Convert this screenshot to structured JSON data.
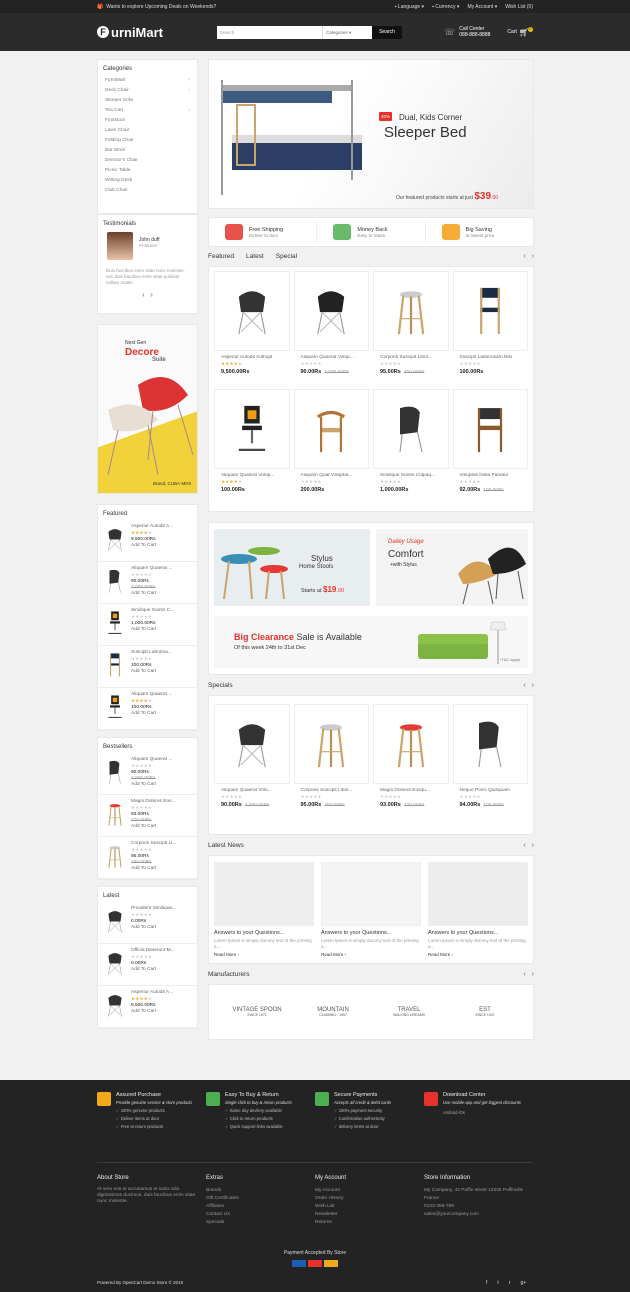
{
  "topbar": {
    "promo": "Wants to explore Upcoming Deals on Weekends?",
    "language": "Language",
    "currency": "Currency",
    "account": "My Account",
    "wishlist": "Wish List (0)"
  },
  "header": {
    "logo_letter": "F",
    "logo_rest": "urniMart",
    "search_placeholder": "Search",
    "search_category": "Categories",
    "search_button": "Search",
    "call_label": "Call Center",
    "call_number": "088-888-8888",
    "cart_label": "Cart",
    "cart_count": "0"
  },
  "sidebar": {
    "categories_title": "Categories",
    "categories": [
      "FurniMart",
      "Deck Chair",
      "Sleeper Sofa",
      "Tea Cart",
      "Footstool",
      "Lawn Chair",
      "Folding Chair",
      "Bar Stool",
      "Director's Chair",
      "Picnic Table",
      "Writing Desk",
      "Club Chair"
    ],
    "testimonials_title": "Testimonials",
    "testimonial": {
      "name": "John duff",
      "role": "Producer",
      "text": "Duis faucibus enim vitae nunc molestie, nec duis faucibus enim vitae pulvinar nullam mattis."
    },
    "promo": {
      "line1": "Next Gen",
      "line2": "Decore",
      "line3": "Suite",
      "brand": "Brand, CUBA-MINI"
    },
    "featured_title": "Featured",
    "featured": [
      {
        "name": "Asperiur Autodit A...",
        "stars": 4,
        "price": "9,500.00Rs",
        "add": "Add To Cart"
      },
      {
        "name": "Aliquam Quaerat ...",
        "stars": 0,
        "price": "90.00Rs",
        "old": "2,000.00Rs",
        "add": "Add To Cart"
      },
      {
        "name": "Similique Suntin C...",
        "stars": 0,
        "price": "1,000.00Rs",
        "add": "Add To Cart"
      },
      {
        "name": "Suscipit Laborioa...",
        "stars": 0,
        "price": "100.00Rs",
        "add": "Add To Cart"
      },
      {
        "name": "Aliquam Quaerat ...",
        "stars": 4,
        "price": "100.00Rs",
        "add": "Add To Cart"
      }
    ],
    "bestsellers_title": "Bestsellers",
    "bestsellers": [
      {
        "name": "Aliquam Quaerat ...",
        "stars": 0,
        "price": "90.00Rs",
        "old": "2,000.00Rs",
        "add": "Add To Cart"
      },
      {
        "name": "Magni Dolores Eos...",
        "stars": 0,
        "price": "93.00Rs",
        "old": "270.00Rs",
        "add": "Add To Cart"
      },
      {
        "name": "Corporis Suscipit Li...",
        "stars": 0,
        "price": "95.00Rs",
        "old": "250.00Rs",
        "add": "Add To Cart"
      }
    ],
    "latest_title": "Latest",
    "latest": [
      {
        "name": "Provident Similique...",
        "stars": 0,
        "price": "0.00Rs",
        "add": "Add To Cart"
      },
      {
        "name": "Officia Deserunt M...",
        "stars": 0,
        "price": "0.00Rs",
        "add": "Add To Cart"
      },
      {
        "name": "Asperiur Autodit A...",
        "stars": 4,
        "price": "9,500.00Rs",
        "add": "Add To Cart"
      }
    ]
  },
  "banner": {
    "off": "40%",
    "sub": "Dual, Kids Corner",
    "title": "Sleeper Bed",
    "featured": "Our featured products starts at just",
    "price": "$39",
    "cents": ".00"
  },
  "services": [
    {
      "title": "Free Shipping",
      "sub": "Deliver to door",
      "color": "#e5322d"
    },
    {
      "title": "Money Back",
      "sub": "Easy to return",
      "color": "#4caf50"
    },
    {
      "title": "Big Saving",
      "sub": "at lowest price",
      "color": "#f39c12"
    }
  ],
  "tabs": [
    "Featured",
    "Latest",
    "Special"
  ],
  "products": [
    {
      "name": "Asperiur Autodit Autfugit",
      "stars": 4,
      "price": "9,500.00Rs",
      "old": "",
      "kind": "shell"
    },
    {
      "name": "Aliquam Quaerat Volup...",
      "stars": 0,
      "price": "90.00Rs",
      "old": "2,000.00Rs",
      "kind": "shellwhite"
    },
    {
      "name": "Corporis Suscipit Libor...",
      "stars": 0,
      "price": "95.00Rs",
      "old": "250.00Rs",
      "kind": "stool"
    },
    {
      "name": "Suscipit Laboriosam Nisi",
      "stars": 0,
      "price": "100.00Rs",
      "old": "",
      "kind": "dining"
    },
    {
      "name": "Aliquam Quaerat Volup...",
      "stars": 4,
      "price": "100.00Rs",
      "old": "",
      "kind": "office"
    },
    {
      "name": "Aliquam Quat Voluptat...",
      "stars": 0,
      "price": "200.00Rs",
      "old": "",
      "kind": "wishbone"
    },
    {
      "name": "Similique Suntin Culpaq...",
      "stars": 0,
      "price": "1,000.00Rs",
      "old": "",
      "kind": "lounge"
    },
    {
      "name": "Voluptas Nulla Pariatur",
      "stars": 0,
      "price": "92.00Rs",
      "old": "100.00Rs",
      "kind": "arm"
    }
  ],
  "mid_banners": {
    "b1_title": "Stylus",
    "b1_sub": "Home Stools",
    "b1_starts": "Starts at",
    "b1_price": "$19",
    "b1_cents": ".00",
    "b2_script": "Dailey Usage",
    "b2_title": "Comfort",
    "b2_sub": "+with Stylus",
    "clear_red": "Big Clearance",
    "clear_rest": "Sale is Available",
    "clear_dates": "Of this week 24th to 31st Dec",
    "tac": "*T&C apply"
  },
  "specials_title": "Specials",
  "specials": [
    {
      "name": "Aliquam Quaerat Volu...",
      "stars": 0,
      "price": "90.00Rs",
      "old": "2,000.00Rs",
      "kind": "shell"
    },
    {
      "name": "Corporis Suscipit Libor...",
      "stars": 0,
      "price": "95.00Rs",
      "old": "250.00Rs",
      "kind": "stool"
    },
    {
      "name": "Magni Dolores Eosqu...",
      "stars": 0,
      "price": "93.00Rs",
      "old": "270.00Rs",
      "kind": "redstool"
    },
    {
      "name": "Neque Porro Quisquam",
      "stars": 0,
      "price": "94.00Rs",
      "old": "100.00Rs",
      "kind": "lounge"
    }
  ],
  "news_title": "Latest News",
  "news": [
    {
      "title": "Answers to your Questions...",
      "desc": "Lorem Ipsum is simply dummy text of the printing a...",
      "read": "Read More ›"
    },
    {
      "title": "Answers to your Questions...",
      "desc": "Lorem Ipsum is simply dummy text of the printing a...",
      "read": "Read More ›"
    },
    {
      "title": "Answers to your Questions...",
      "desc": "Lorem Ipsum is simply dummy text of the printing a...",
      "read": "Read More ›"
    }
  ],
  "manufacturers_title": "Manufacturers",
  "manufacturers": [
    {
      "main": "VINTAGE SPOON",
      "sub": "SINCE 1972"
    },
    {
      "main": "MOUNTAIN",
      "sub": "CLIMBING · 1957"
    },
    {
      "main": "TRAVEL",
      "sub": "WALKING DREAMS"
    },
    {
      "main": "EST",
      "sub": "SINCE 1947"
    }
  ],
  "footer": {
    "features": [
      {
        "title": "Assured Purchase",
        "desc": "Provide genuine service & store products",
        "items": [
          "100% genuine products",
          "Deliver items at door",
          "Free to return products"
        ],
        "color": "#f0a91a"
      },
      {
        "title": "Easy To Buy & Return",
        "desc": "Single click to buy & return products",
        "items": [
          "Same day devilery available",
          "Click to return products",
          "Quick support links available"
        ],
        "color": "#4caf50"
      },
      {
        "title": "Secure Payments",
        "desc": "Accepts all credit & debit cards",
        "items": [
          "100% payment security",
          "Confirmation authenticity",
          "delivery items at door"
        ],
        "color": "#4caf50"
      },
      {
        "title": "Download Center",
        "desc": "Use mobile-app and get biggest discounts",
        "items": [],
        "android": "Android",
        "ios": "iOs",
        "color": "#e5322d"
      }
    ],
    "about_title": "About Store",
    "about_text": "At vero eos et accusamus et iusto odio dignissimos ducimus, duis faucibus enim vitae nunc molestie.",
    "extras_title": "Extras",
    "extras": [
      "Brands",
      "Gift Certificates",
      "Affiliates",
      "Contact Us",
      "Specials"
    ],
    "account_title": "My Account",
    "account": [
      "My Account",
      "Order History",
      "Wish List",
      "Newsletter",
      "Returns"
    ],
    "info_title": "Store Information",
    "info": [
      "My Company, 42 Puffin street 12345 Puffinville France",
      "0123-456-789",
      "sales@yourcompany.com"
    ],
    "payment": "Payment Accepted By Store",
    "copyright": "Powered By OpenCart Demo Store © 2015"
  }
}
